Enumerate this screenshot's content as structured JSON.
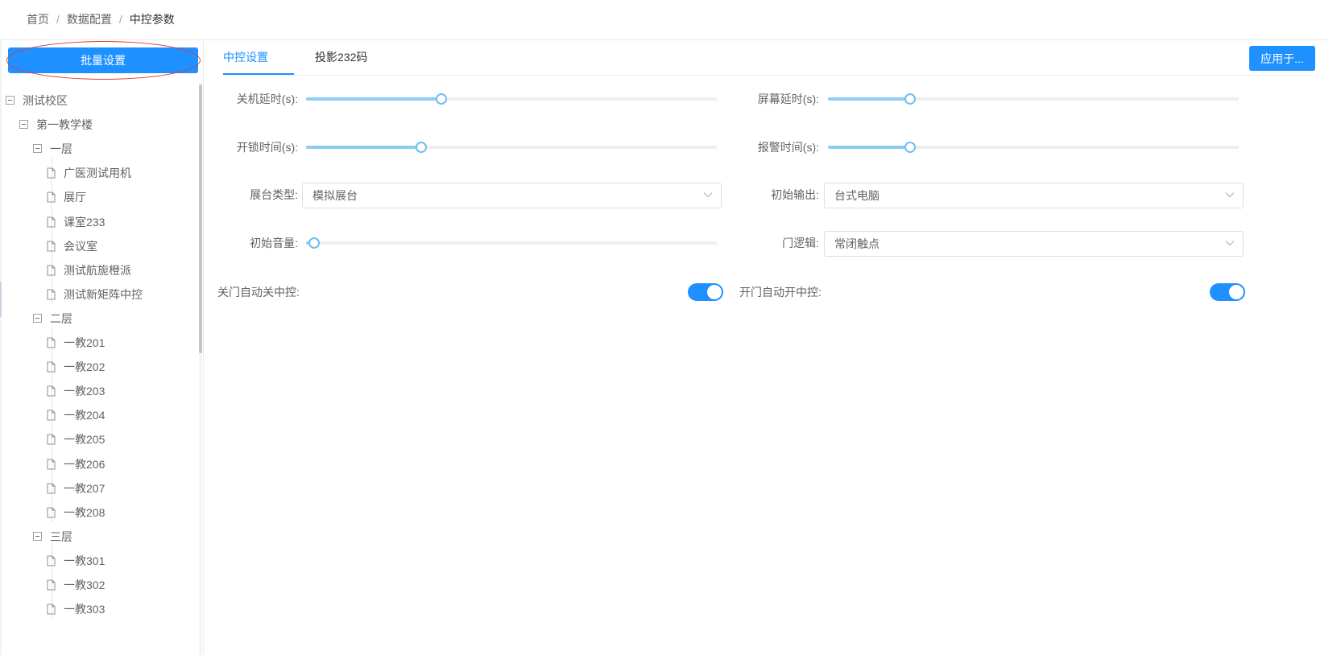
{
  "breadcrumb": {
    "items": [
      "首页",
      "数据配置",
      "中控参数"
    ],
    "separator": "/"
  },
  "sidebar": {
    "batch_button": "批量设置"
  },
  "tree": [
    {
      "label": "测试校区",
      "type": "folder"
    },
    {
      "label": "第一教学楼",
      "type": "folder"
    },
    {
      "label": "一层",
      "type": "folder"
    },
    {
      "label": "广医测试用机",
      "type": "leaf"
    },
    {
      "label": "展厅",
      "type": "leaf"
    },
    {
      "label": "课室233",
      "type": "leaf"
    },
    {
      "label": "会议室",
      "type": "leaf"
    },
    {
      "label": "测试航旎橙派",
      "type": "leaf"
    },
    {
      "label": "测试新矩阵中控",
      "type": "leaf"
    },
    {
      "label": "二层",
      "type": "folder"
    },
    {
      "label": "一教201",
      "type": "leaf"
    },
    {
      "label": "一教202",
      "type": "leaf"
    },
    {
      "label": "一教203",
      "type": "leaf"
    },
    {
      "label": "一教204",
      "type": "leaf"
    },
    {
      "label": "一教205",
      "type": "leaf"
    },
    {
      "label": "一教206",
      "type": "leaf"
    },
    {
      "label": "一教207",
      "type": "leaf"
    },
    {
      "label": "一教208",
      "type": "leaf"
    },
    {
      "label": "三层",
      "type": "folder"
    },
    {
      "label": "一教301",
      "type": "leaf"
    },
    {
      "label": "一教302",
      "type": "leaf"
    },
    {
      "label": "一教303",
      "type": "leaf"
    }
  ],
  "tabs": [
    {
      "label": "中控设置",
      "active": true
    },
    {
      "label": "投影232码",
      "active": false
    }
  ],
  "apply_button": "应用于...",
  "form": {
    "shutdown_delay": {
      "label": "关机延时(s):",
      "level": 0.33
    },
    "screen_delay": {
      "label": "屏幕延时(s):",
      "level": 0.2
    },
    "unlock_time": {
      "label": "开锁时间(s):",
      "level": 0.28
    },
    "alarm_time": {
      "label": "报警时间(s):",
      "level": 0.2
    },
    "booth_type": {
      "label": "展台类型:",
      "value": "模拟展台"
    },
    "initial_output": {
      "label": "初始输出:",
      "value": "台式电脑"
    },
    "initial_volume": {
      "label": "初始音量:",
      "level": 0.02
    },
    "door_logic": {
      "label": "门逻辑:",
      "value": "常闭触点"
    },
    "close_door_auto_off": {
      "label": "关门自动关中控:",
      "on": true
    },
    "open_door_auto_on": {
      "label": "开门自动开中控:",
      "on": true
    }
  },
  "colors": {
    "accent": "#1e90ff",
    "slider_fill": "#8ccdf3",
    "ring": "#e53935"
  }
}
